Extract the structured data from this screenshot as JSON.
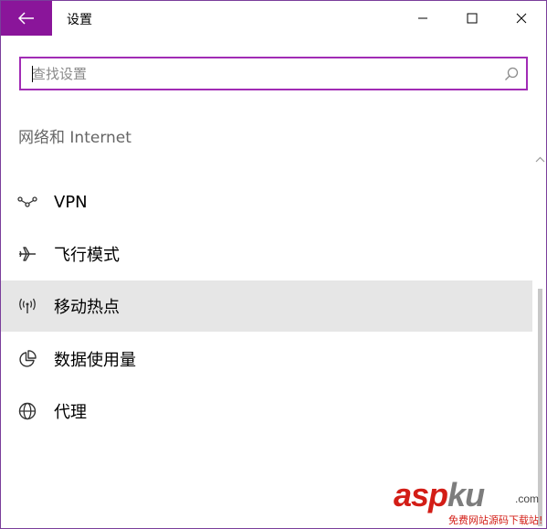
{
  "window": {
    "title": "设置",
    "accent": "#8a159a",
    "minimize_icon": "minimize-icon",
    "maximize_icon": "maximize-icon",
    "close_icon": "close-icon"
  },
  "search": {
    "placeholder": "查找设置",
    "value": "",
    "icon": "search-icon"
  },
  "section": {
    "title": "网络和 Internet"
  },
  "nav": {
    "items": [
      {
        "label": "VPN",
        "icon": "vpn-icon",
        "selected": false
      },
      {
        "label": "飞行模式",
        "icon": "airplane-icon",
        "selected": false
      },
      {
        "label": "移动热点",
        "icon": "hotspot-icon",
        "selected": true
      },
      {
        "label": "数据使用量",
        "icon": "data-usage-icon",
        "selected": false
      },
      {
        "label": "代理",
        "icon": "globe-icon",
        "selected": false
      }
    ]
  },
  "watermark": {
    "logo_main": "asp",
    "logo_accent": "ku",
    "logo_suffix": ".com",
    "subtitle": "免费网站源码下载站!"
  }
}
